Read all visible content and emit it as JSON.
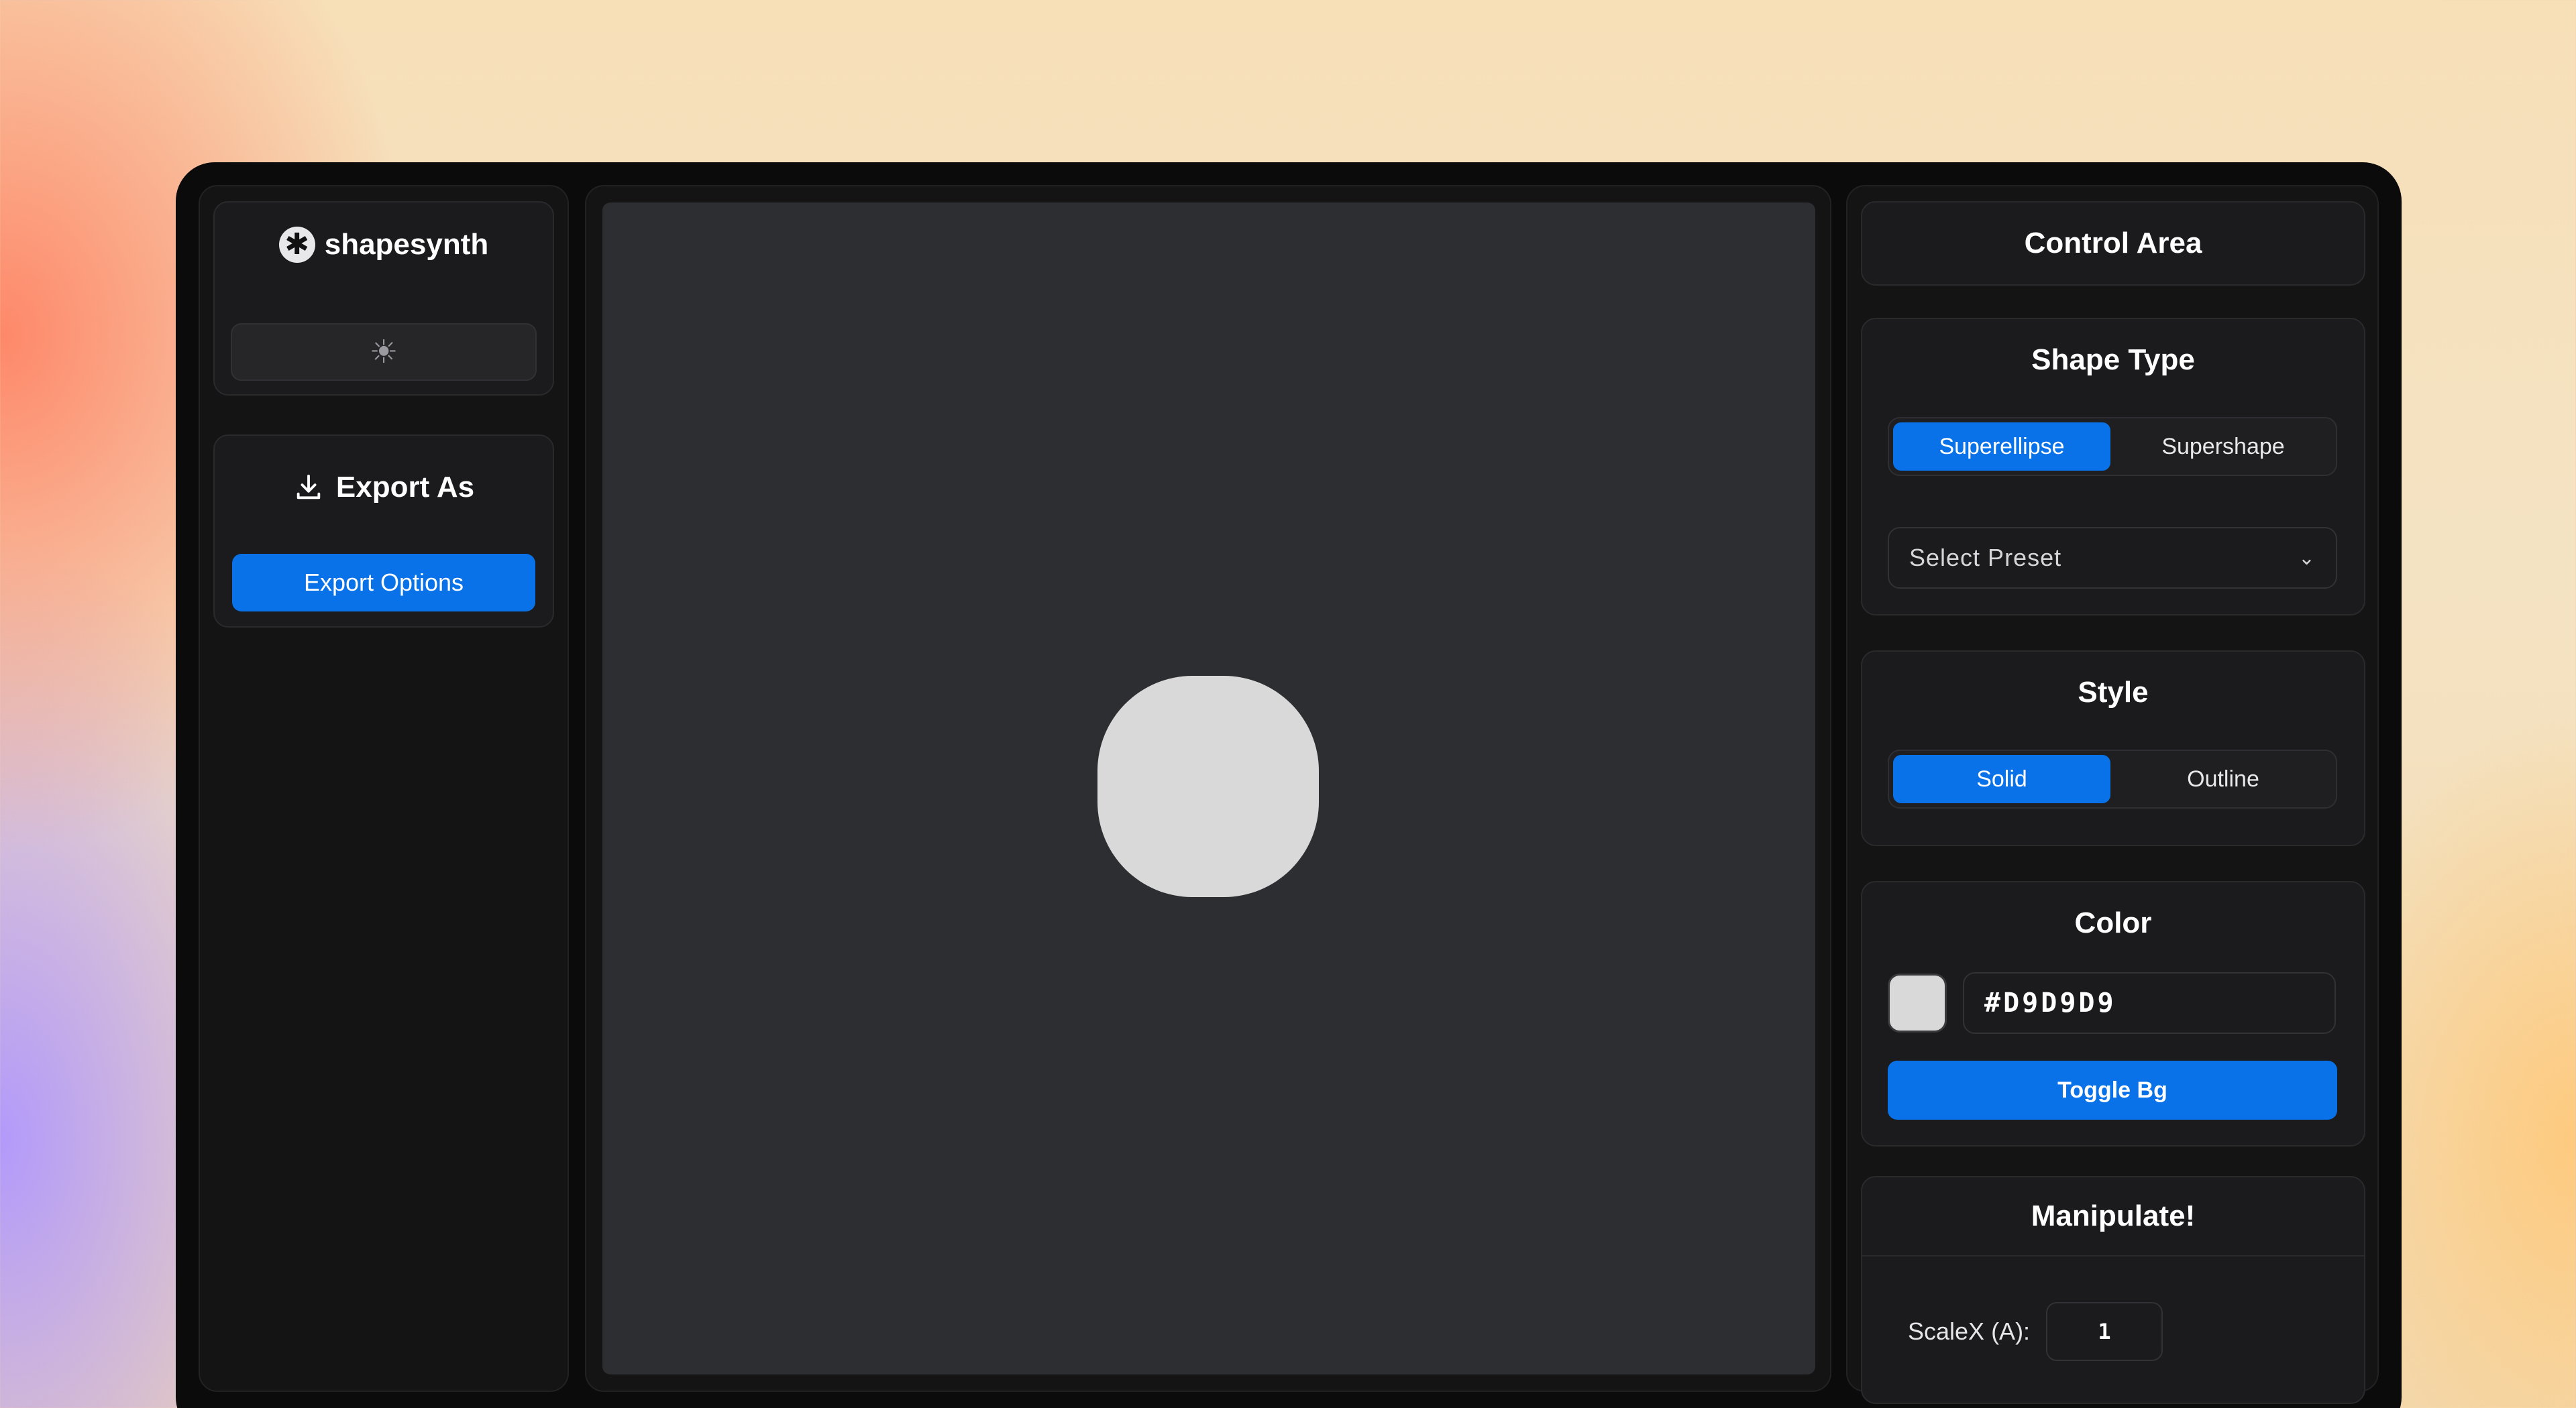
{
  "app": {
    "name": "shapesynth",
    "logo_glyph": "✱"
  },
  "theme_toggle": {
    "icon": "sun-icon",
    "glyph": "☀"
  },
  "export": {
    "title": "Export As",
    "icon": "download-icon",
    "button_label": "Export Options"
  },
  "canvas": {
    "background": "#2d2e31",
    "shape_color": "#d9d9d9"
  },
  "control_area": {
    "title": "Control Area",
    "shape_type": {
      "title": "Shape Type",
      "options": [
        "Superellipse",
        "Supershape"
      ],
      "selected": "Superellipse",
      "preset_placeholder": "Select Preset",
      "preset_chevron": "⌄"
    },
    "style": {
      "title": "Style",
      "options": [
        "Solid",
        "Outline"
      ],
      "selected": "Solid"
    },
    "color": {
      "title": "Color",
      "swatch": "#D9D9D9",
      "hex_value": "#D9D9D9",
      "toggle_bg_label": "Toggle Bg"
    },
    "manipulate": {
      "title": "Manipulate!",
      "scale_x_label": "ScaleX (A):",
      "scale_x_value": "1"
    }
  },
  "colors": {
    "accent": "#0a72e8",
    "window": "#0b0b0c",
    "panel": "#141415"
  }
}
